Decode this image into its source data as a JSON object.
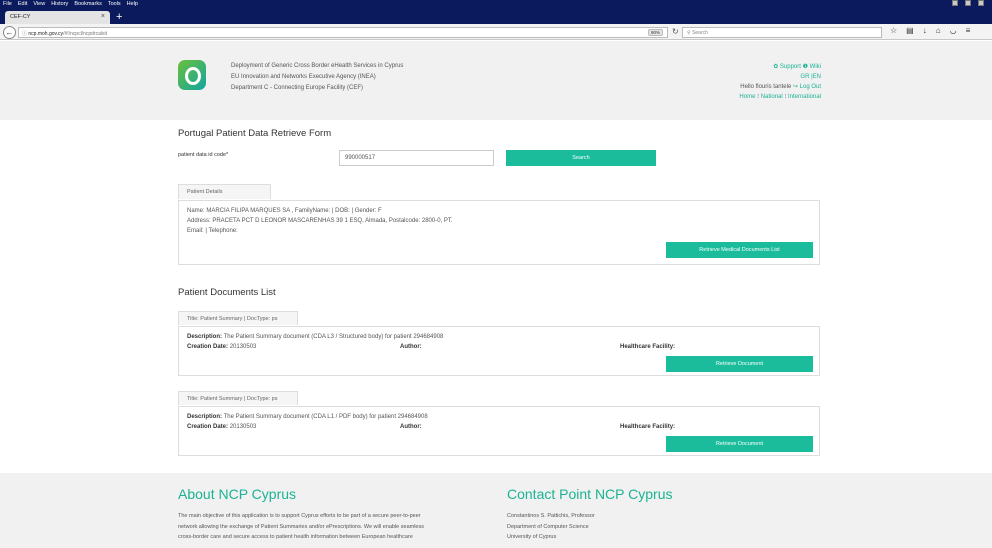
{
  "browser": {
    "menu": [
      "File",
      "Edit",
      "View",
      "History",
      "Bookmarks",
      "Tools",
      "Help"
    ],
    "tab_title": "CEF-CY",
    "url_host": "ncp.moh.gov.cy",
    "url_path": "/#!/ncpcl/ncpdrcalsit",
    "zoom": "90%",
    "search_placeholder": "Search"
  },
  "header": {
    "org_line1": "Deployment of Generic Cross Border eHealth Services in Cyprus",
    "org_line2": "EU Innovation and Networks Executive Agency (INEA)",
    "org_line3": "Department C - Connecting Europe Facility (CEF)",
    "support": "Support",
    "wiki": "Wiki",
    "lang_gr": "GR",
    "lang_sep": "|",
    "lang_en": "EN",
    "hello": "Hello flouris tantele",
    "logout": "Log Out",
    "nav_home": "Home",
    "nav_national": "National",
    "nav_international": "International"
  },
  "form": {
    "title": "Portugal Patient Data Retrieve Form",
    "id_label": "patient data id code*",
    "id_value": "990000517",
    "search_label": "Search"
  },
  "details": {
    "tab": "Patient Details",
    "line1": "Name: MARCIA FILIPA MARQUES SA , FamilyName: | DOB: | Gender: F",
    "line2": "Address: PRACETA PCT D LEONOR MASCARENHAS 39 1 ESQ, Almada, Postalcode: 2800-0, PT.",
    "line3": "Email: | Telephone:",
    "retrieve_list_label": "Retrieve Medical Documents List"
  },
  "documents": {
    "title": "Patient Documents List",
    "description_label": "Description:",
    "creation_label": "Creation Date:",
    "author_label": "Author:",
    "facility_label": "Healthcare Facility:",
    "retrieve_label": "Retrieve Document",
    "items": [
      {
        "tab": "Title: Patient Summary | DocType: ps",
        "description": "The Patient Summary document (CDA L3 / Structured body) for patient 294684908",
        "creation_date": "20130503"
      },
      {
        "tab": "Title: Patient Summary | DocType: ps",
        "description": "The Patient Summary document (CDA L1 / PDF body) for patient 294684908",
        "creation_date": "20130503"
      }
    ]
  },
  "footer": {
    "about_title": "About NCP Cyprus",
    "about_lines": [
      "The main objective of this application is to support Cyprus efforts to be part of a secure peer-to-peer",
      "network allowing the exchange of Patient Summaries and/or ePrescriptions. We will enable seamless",
      "cross-border care and secure access to patient health information between European healthcare"
    ],
    "contact_title": "Contact Point NCP Cyprus",
    "contact_lines": [
      "Constantinos S. Pattichis, Professor",
      "Department of Computer Science",
      "University of Cyprus"
    ]
  }
}
